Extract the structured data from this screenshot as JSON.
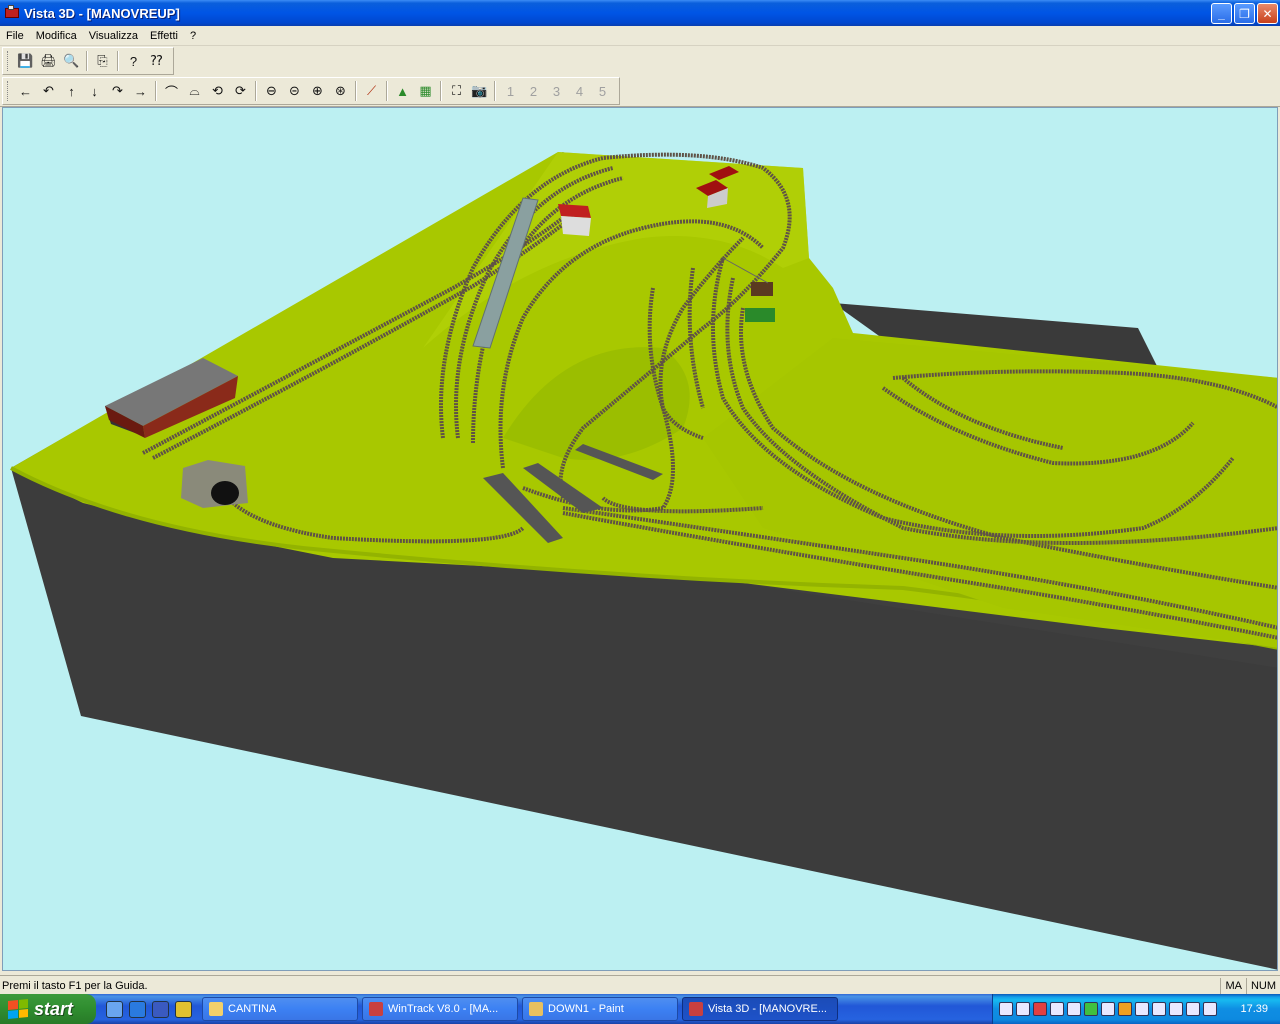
{
  "window": {
    "title": "Vista 3D - [MANOVREUP]",
    "controls": {
      "minimize": "_",
      "restore": "❐",
      "close": "✕"
    }
  },
  "menu": [
    "File",
    "Modifica",
    "Visualizza",
    "Effetti",
    "?"
  ],
  "toolbar1": [
    {
      "name": "save-icon",
      "glyph": "💾"
    },
    {
      "name": "print-icon",
      "glyph": "🖨"
    },
    {
      "name": "print-preview-icon",
      "glyph": "🔍"
    },
    {
      "name": "copy-icon",
      "glyph": "⎘"
    },
    {
      "name": "help-icon",
      "glyph": "?"
    },
    {
      "name": "context-help-icon",
      "glyph": "⁇"
    }
  ],
  "toolbar2": {
    "navigation": [
      {
        "name": "move-left-icon",
        "glyph": "←"
      },
      {
        "name": "rotate-left-icon",
        "glyph": "↶"
      },
      {
        "name": "move-up-icon",
        "glyph": "↑"
      },
      {
        "name": "move-down-icon",
        "glyph": "↓"
      },
      {
        "name": "rotate-right-icon",
        "glyph": "↷"
      },
      {
        "name": "move-right-icon",
        "glyph": "→"
      }
    ],
    "camera": [
      {
        "name": "camera-tilt-up-icon",
        "glyph": "⌒"
      },
      {
        "name": "camera-tilt-down-icon",
        "glyph": "⌓"
      },
      {
        "name": "camera-orbit-left-icon",
        "glyph": "⟲"
      },
      {
        "name": "camera-orbit-right-icon",
        "glyph": "⟳"
      }
    ],
    "zoom": [
      {
        "name": "zoom-out-icon",
        "glyph": "⊖"
      },
      {
        "name": "zoom-out-small-icon",
        "glyph": "⊝"
      },
      {
        "name": "zoom-in-icon",
        "glyph": "⊕"
      },
      {
        "name": "zoom-in-small-icon",
        "glyph": "⊛"
      }
    ],
    "track": [
      {
        "name": "track-icon",
        "glyph": "⟋"
      }
    ],
    "terrain": [
      {
        "name": "terrain-icon",
        "glyph": "▲"
      },
      {
        "name": "grid-icon",
        "glyph": "▦"
      }
    ],
    "view": [
      {
        "name": "fit-view-icon",
        "glyph": "⛶"
      },
      {
        "name": "camera-icon",
        "glyph": "📷"
      }
    ],
    "positions": [
      {
        "name": "position-1-icon",
        "glyph": "1"
      },
      {
        "name": "position-2-icon",
        "glyph": "2"
      },
      {
        "name": "position-3-icon",
        "glyph": "3"
      },
      {
        "name": "position-4-icon",
        "glyph": "4"
      },
      {
        "name": "position-5-icon",
        "glyph": "5"
      }
    ]
  },
  "status": {
    "text": "Premi il tasto F1 per la Guida.",
    "indicators": [
      "MA",
      "NUM"
    ]
  },
  "taskbar": {
    "start_label": "start",
    "tasks": [
      {
        "label": "CANTINA",
        "active": false,
        "icon_color": "#f2d06b"
      },
      {
        "label": "WinTrack  V8.0 - [MA...",
        "active": false,
        "icon_color": "#c84040"
      },
      {
        "label": "DOWN1 - Paint",
        "active": false,
        "icon_color": "#e8c060"
      },
      {
        "label": "Vista 3D - [MANOVRE...",
        "active": true,
        "icon_color": "#c84040"
      }
    ],
    "clock": "17.39"
  },
  "colors": {
    "sky": "#bcf0f2",
    "terrain": "#a8c800",
    "base": "#3f3f3f",
    "track": "#6a5a4a"
  }
}
